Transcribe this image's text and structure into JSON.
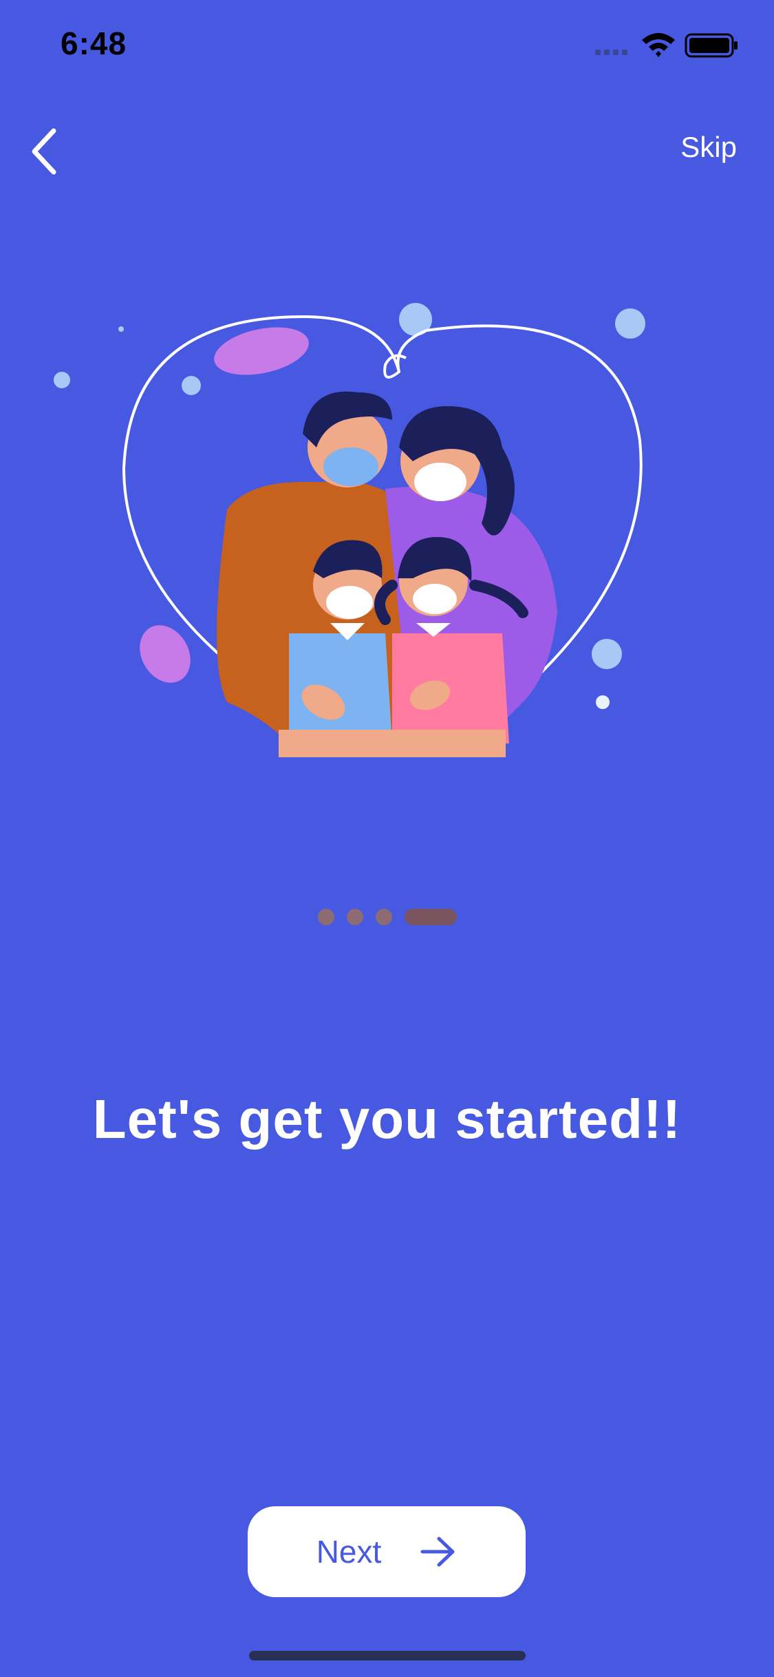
{
  "status_bar": {
    "time": "6:48",
    "icons": [
      "cellular-signal-icon",
      "wifi-icon",
      "battery-icon"
    ]
  },
  "nav": {
    "back_icon": "chevron-left-icon",
    "skip_label": "Skip"
  },
  "illustration": {
    "description_icon": "family-with-masks-illustration"
  },
  "pager": {
    "count": 4,
    "active_index": 3
  },
  "headline": "Let's get you started!!",
  "next_button": {
    "label": "Next",
    "icon": "arrow-right-icon"
  },
  "colors": {
    "background": "#4759E0",
    "button_bg": "#FFFFFF",
    "accent": "#4759E0",
    "pager_dot": "#8C6C72"
  }
}
